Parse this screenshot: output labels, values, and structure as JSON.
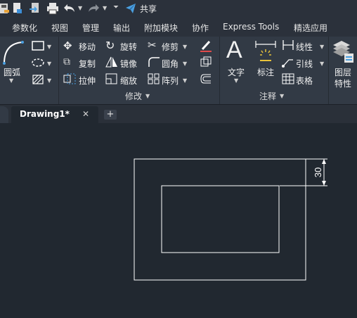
{
  "quick_access": {
    "share_label": "共享"
  },
  "menu": {
    "items": [
      "参数化",
      "视图",
      "管理",
      "输出",
      "附加模块",
      "协作",
      "Express Tools",
      "精选应用"
    ]
  },
  "ribbon": {
    "draw_panel": {
      "arc_label": "圆弧"
    },
    "modify_panel": {
      "label": "修改",
      "tools": {
        "move": "移动",
        "rotate": "旋转",
        "trim": "修剪",
        "copy": "复制",
        "mirror": "镜像",
        "fillet": "圆角",
        "stretch": "拉伸",
        "scale": "缩放",
        "array": "阵列"
      }
    },
    "annotation_panel": {
      "label": "注释",
      "tools": {
        "text": "文字",
        "dimension": "标注",
        "linear": "线性",
        "leader": "引线",
        "table": "表格"
      }
    },
    "layers_panel": {
      "label_line1": "图层",
      "label_line2": "特性"
    }
  },
  "document_tabs": {
    "active_tab": "Drawing1*",
    "close_glyph": "✕",
    "new_tab_glyph": "+"
  },
  "drawing": {
    "dimension_text": "30"
  },
  "colors": {
    "canvas_bg": "#212830",
    "ribbon_bg": "#323a45",
    "accent_blue": "#4a9fe0",
    "line_color": "#ffffff"
  }
}
